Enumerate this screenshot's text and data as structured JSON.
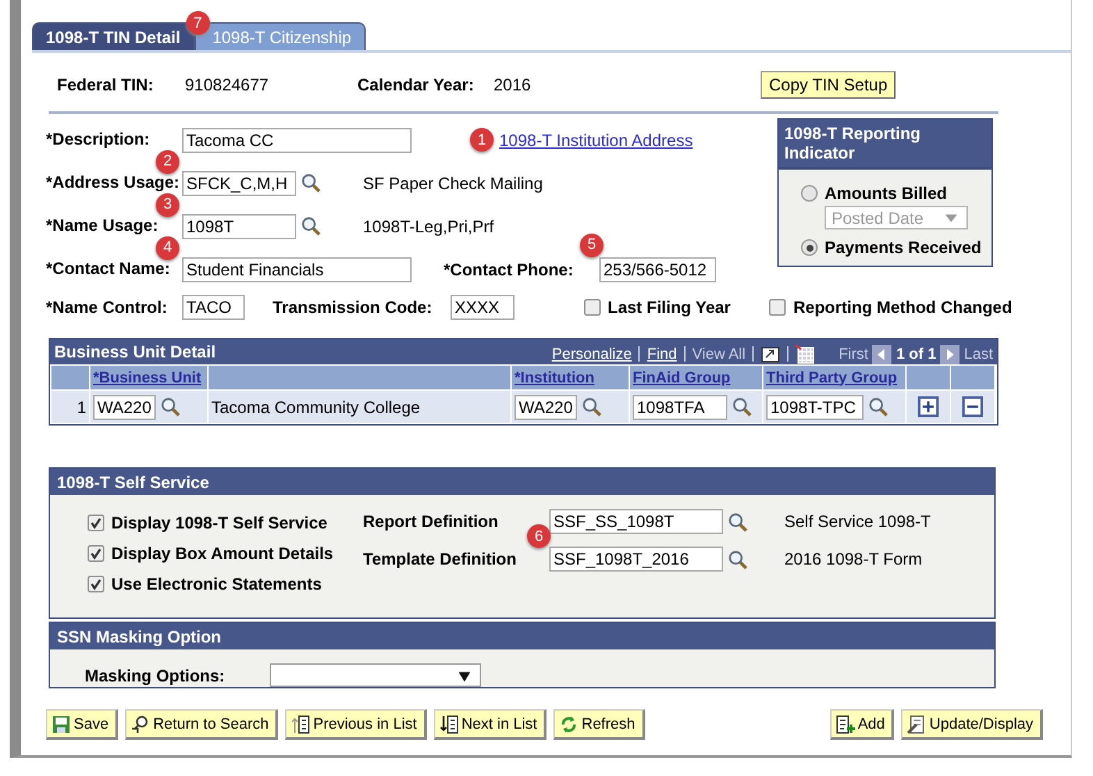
{
  "tabs": [
    {
      "label": "1098-T TIN Detail",
      "selected": true
    },
    {
      "label": "1098-T Citizenship",
      "selected": false,
      "callout": "7"
    }
  ],
  "header": {
    "federal_tin_label": "Federal TIN:",
    "federal_tin": "910824677",
    "calendar_year_label": "Calendar Year:",
    "calendar_year": "2016",
    "copy_button": "Copy TIN Setup"
  },
  "description": {
    "label": "*Description:",
    "value": "Tacoma CC",
    "link": "1098-T Institution Address",
    "link_callout": "1"
  },
  "address_usage": {
    "label": "*Address Usage:",
    "value": "SFCK_C,M,H",
    "description": "SF Paper Check Mailing",
    "callout": "2"
  },
  "name_usage": {
    "label": "*Name Usage:",
    "value": "1098T",
    "description": "1098T-Leg,Pri,Prf",
    "callout": "3"
  },
  "contact_name": {
    "label": "*Contact Name:",
    "value": "Student Financials",
    "callout": "4"
  },
  "contact_phone": {
    "label": "*Contact Phone:",
    "value": "253/566-5012",
    "callout": "5"
  },
  "name_control": {
    "label": "*Name Control:",
    "value": "TACO"
  },
  "transmission_code": {
    "label": "Transmission Code:",
    "value": "XXXX"
  },
  "flags": [
    {
      "label": "Last Filing Year",
      "checked": false
    },
    {
      "label": "Reporting Method Changed",
      "checked": false
    }
  ],
  "reporting_indicator": {
    "title": "1098-T Reporting Indicator",
    "options": [
      {
        "label": "Amounts Billed",
        "selected": false
      },
      {
        "label": "Payments Received",
        "selected": true
      }
    ],
    "date_select": {
      "value": "Posted Date",
      "disabled": true
    }
  },
  "business_unit_grid": {
    "title": "Business Unit Detail",
    "personalize": "Personalize",
    "find": "Find",
    "view_all": "View All",
    "first": "First",
    "count": "1 of 1",
    "last": "Last",
    "columns": {
      "business_unit": "*Business Unit",
      "institution": "*Institution",
      "finaid_group": "FinAid Group",
      "third_party_group": "Third Party Group"
    },
    "rows": [
      {
        "row_number": "1",
        "business_unit": "WA220",
        "description": "Tacoma Community College",
        "institution": "WA220",
        "finaid_group": "1098TFA",
        "third_party_group": "1098T-TPC"
      }
    ]
  },
  "self_service": {
    "title": "1098-T Self Service",
    "options": [
      {
        "label": "Display 1098-T Self Service",
        "checked": true
      },
      {
        "label": "Display Box Amount Details",
        "checked": true
      },
      {
        "label": "Use Electronic Statements",
        "checked": true
      }
    ],
    "definitions": [
      {
        "label": "Report Definition",
        "value": "SSF_SS_1098T",
        "description": "Self Service 1098-T"
      },
      {
        "label": "Template Definition",
        "value": "SSF_1098T_2016",
        "description": "2016 1098-T Form",
        "callout": "6"
      }
    ]
  },
  "ssn_masking": {
    "title": "SSN Masking Option",
    "label": "Masking Options:"
  },
  "buttons_left": [
    {
      "kind": "save",
      "label": "Save"
    },
    {
      "kind": "return",
      "label": "Return to Search"
    },
    {
      "kind": "previous",
      "label": "Previous in List"
    },
    {
      "kind": "next",
      "label": "Next in List"
    },
    {
      "kind": "refresh",
      "label": "Refresh"
    }
  ],
  "buttons_right": [
    {
      "kind": "add",
      "label": "Add"
    },
    {
      "kind": "update",
      "label": "Update/Display"
    }
  ]
}
